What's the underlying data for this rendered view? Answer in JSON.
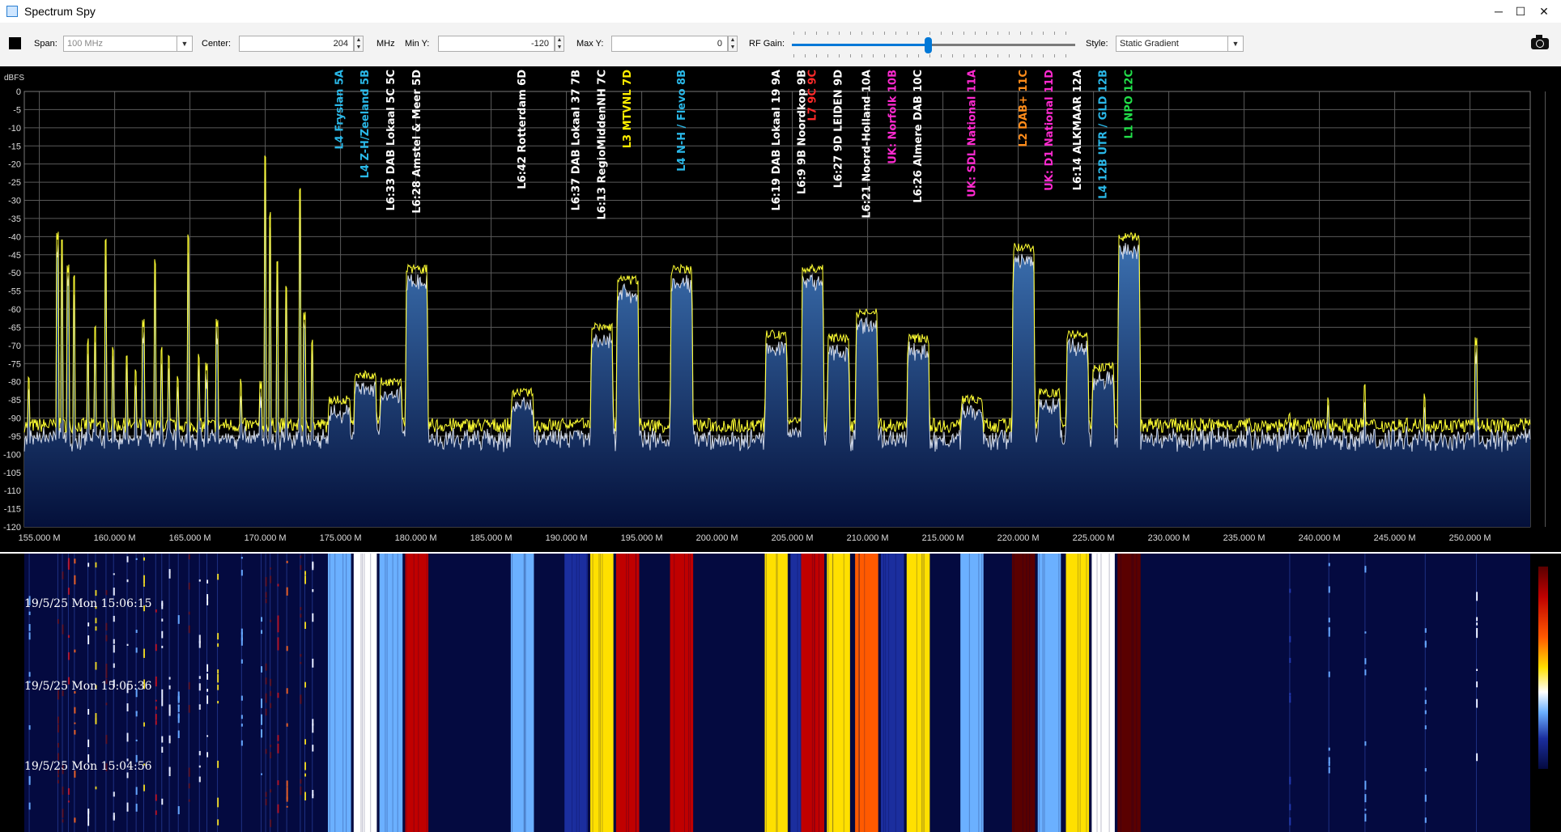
{
  "window": {
    "title": "Spectrum Spy",
    "controls": [
      "─",
      "☐",
      "✕"
    ]
  },
  "toolbar": {
    "span_label": "Span:",
    "span_value": "100 MHz",
    "center_label": "Center:",
    "center_value": "204",
    "center_unit": "MHz",
    "miny_label": "Min Y:",
    "miny_value": "-120",
    "maxy_label": "Max Y:",
    "maxy_value": "0",
    "rfgain_label": "RF Gain:",
    "rfgain_level": 0.48,
    "style_label": "Style:",
    "style_value": "Static Gradient"
  },
  "colors": {
    "trace_max": "#ffff33",
    "trace_live": "#d0d8e8",
    "grid": "#5a5a5a",
    "fill_top": "#4a8ad0",
    "fill_bottom": "#04103a"
  },
  "chart_data": {
    "type": "line",
    "ylabel": "dBFS",
    "ylim": [
      -120,
      0
    ],
    "xlim_mhz": [
      154,
      254
    ],
    "yticks": [
      "0",
      "-5",
      "-10",
      "-15",
      "-20",
      "-25",
      "-30",
      "-35",
      "-40",
      "-45",
      "-50",
      "-55",
      "-60",
      "-65",
      "-70",
      "-75",
      "-80",
      "-85",
      "-90",
      "-95",
      "-100",
      "-105",
      "-110",
      "-115",
      "-120"
    ],
    "xtick_labels": [
      "155.000 M",
      "160.000 M",
      "165.000 M",
      "170.000 M",
      "175.000 M",
      "180.000 M",
      "185.000 M",
      "190.000 M",
      "195.000 M",
      "200.000 M",
      "205.000 M",
      "210.000 M",
      "215.000 M",
      "220.000 M",
      "225.000 M",
      "230.000 M",
      "235.000 M",
      "240.000 M",
      "245.000 M",
      "250.000 M"
    ],
    "noise_floor_db": -92,
    "channels": [
      {
        "freq": 174.928,
        "level": -84,
        "label": "L4 Fryslan",
        "block": "5A",
        "color": "#2ab8e8"
      },
      {
        "freq": 176.64,
        "level": -77,
        "label": "L4 Z-H/Zeeland",
        "block": "5B",
        "color": "#2ab8e8"
      },
      {
        "freq": 178.352,
        "level": -79,
        "label": "L6:33 DAB Lokaal 5C",
        "block": "5C",
        "color": "#ffffff"
      },
      {
        "freq": 180.064,
        "level": -48,
        "label": "L6:28 Amstel & Meer",
        "block": "5D",
        "color": "#ffffff"
      },
      {
        "freq": 187.072,
        "level": -82,
        "label": "L6:42 Rotterdam",
        "block": "6D",
        "color": "#ffffff"
      },
      {
        "freq": 190.64,
        "level": -91,
        "label": "L6:37 DAB Lokaal 37",
        "block": "7B",
        "color": "#ffffff"
      },
      {
        "freq": 192.352,
        "level": -64,
        "label": "L6:13 RegioMiddenNH",
        "block": "7C",
        "color": "#ffffff"
      },
      {
        "freq": 194.064,
        "level": -51,
        "label": "L3 MTVNL",
        "block": "7D",
        "color": "#ffee00"
      },
      {
        "freq": 197.648,
        "level": -48,
        "label": "L4 N-H / Flevo",
        "block": "8B",
        "color": "#2ab8e8"
      },
      {
        "freq": 203.936,
        "level": -66,
        "label": "L6:19 DAB Lokaal 19",
        "block": "9A",
        "color": "#ffffff"
      },
      {
        "freq": 205.648,
        "level": -90,
        "label": "L6:9 9B Noordkop",
        "block": "9B",
        "color": "#ffffff"
      },
      {
        "freq": 206.352,
        "level": -48,
        "label": "L7 9C",
        "block": "9C",
        "color": "#ff2a2a"
      },
      {
        "freq": 208.064,
        "level": -67,
        "label": "L6:27 9D LEIDEN",
        "block": "9D",
        "color": "#ffffff"
      },
      {
        "freq": 209.936,
        "level": -60,
        "label": "L6:21 Noord-Holland",
        "block": "10A",
        "color": "#ffffff"
      },
      {
        "freq": 211.648,
        "level": -93,
        "label": "UK: Norfolk",
        "block": "10B",
        "color": "#ff2ad0"
      },
      {
        "freq": 213.36,
        "level": -67,
        "label": "L6:26 Almere DAB",
        "block": "10C",
        "color": "#ffffff"
      },
      {
        "freq": 216.928,
        "level": -84,
        "label": "UK: SDL National",
        "block": "11A",
        "color": "#ff2ad0"
      },
      {
        "freq": 220.352,
        "level": -42,
        "label": "L2 DAB+",
        "block": "11C",
        "color": "#ff8c1a"
      },
      {
        "freq": 222.064,
        "level": -82,
        "label": "UK: D1 National",
        "block": "11D",
        "color": "#ff2ad0"
      },
      {
        "freq": 223.936,
        "level": -66,
        "label": "L6:14 ALKMAAR",
        "block": "12A",
        "color": "#ffffff"
      },
      {
        "freq": 225.648,
        "level": -75,
        "label": "L4 12B UTR / GLD",
        "block": "12B",
        "color": "#2ab8e8"
      },
      {
        "freq": 227.36,
        "level": -39,
        "label": "L1 NPO",
        "block": "12C",
        "color": "#22e04a"
      }
    ],
    "spikes": [
      {
        "freq": 154.3,
        "level": -80
      },
      {
        "freq": 156.2,
        "level": -41
      },
      {
        "freq": 156.5,
        "level": -42
      },
      {
        "freq": 156.9,
        "level": -50
      },
      {
        "freq": 157.3,
        "level": -52
      },
      {
        "freq": 158.2,
        "level": -70
      },
      {
        "freq": 158.7,
        "level": -66
      },
      {
        "freq": 159.4,
        "level": -42
      },
      {
        "freq": 159.9,
        "level": -72
      },
      {
        "freq": 160.8,
        "level": -74
      },
      {
        "freq": 161.4,
        "level": -78
      },
      {
        "freq": 161.9,
        "level": -65
      },
      {
        "freq": 162.7,
        "level": -48
      },
      {
        "freq": 163.1,
        "level": -72
      },
      {
        "freq": 163.6,
        "level": -74
      },
      {
        "freq": 164.2,
        "level": -80
      },
      {
        "freq": 164.9,
        "level": -41
      },
      {
        "freq": 165.6,
        "level": -74
      },
      {
        "freq": 166.1,
        "level": -77
      },
      {
        "freq": 166.8,
        "level": -65
      },
      {
        "freq": 168.4,
        "level": -81
      },
      {
        "freq": 169.7,
        "level": -82
      },
      {
        "freq": 170.0,
        "level": -19
      },
      {
        "freq": 170.3,
        "level": -35
      },
      {
        "freq": 170.8,
        "level": -48
      },
      {
        "freq": 171.4,
        "level": -55
      },
      {
        "freq": 172.3,
        "level": -28
      },
      {
        "freq": 172.6,
        "level": -63
      },
      {
        "freq": 173.1,
        "level": -70
      },
      {
        "freq": 238.0,
        "level": -90
      },
      {
        "freq": 240.6,
        "level": -86
      },
      {
        "freq": 243.0,
        "level": -82
      },
      {
        "freq": 247.0,
        "level": -85
      },
      {
        "freq": 250.4,
        "level": -70
      }
    ]
  },
  "waterfall": {
    "timestamps": [
      "19/5/25 Mon 15:06:15",
      "19/5/25 Mon 15:05:36",
      "19/5/25 Mon 15:04:56"
    ],
    "colormap": [
      "#040a40",
      "#1b2e9e",
      "#6bb0ff",
      "#ffffff",
      "#ffe000",
      "#ff5a00",
      "#c00000",
      "#5a0000"
    ]
  }
}
